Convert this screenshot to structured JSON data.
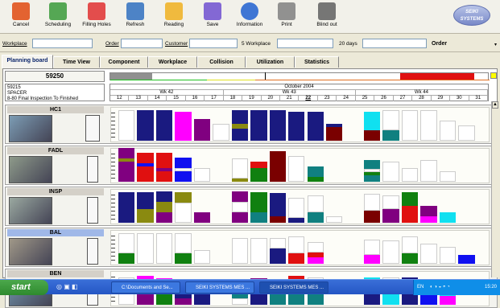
{
  "toolbar": {
    "buttons": [
      {
        "label": "Cancel",
        "icon": "cancel-icon"
      },
      {
        "label": "Scheduling",
        "icon": "scheduling-icon"
      },
      {
        "label": "Filling Holes",
        "icon": "filling-holes-icon"
      },
      {
        "label": "Refresh",
        "icon": "refresh-icon"
      },
      {
        "label": "Reading",
        "icon": "reading-icon"
      },
      {
        "label": "Save",
        "icon": "save-icon"
      },
      {
        "label": "Information",
        "icon": "information-icon"
      },
      {
        "label": "Print",
        "icon": "printer-icon"
      },
      {
        "label": "Blind out",
        "icon": "blind-out-icon"
      }
    ],
    "logo": "SEIKI SYSTEMS"
  },
  "filter": {
    "workplace": "Workplace",
    "order": "Order",
    "customer": "Customer",
    "workplace5": "5 Workplace",
    "days20": "20 days",
    "order2": "Order"
  },
  "tabs": [
    "Planning board",
    "Time View",
    "Component",
    "Workplace",
    "Collision",
    "Utilization",
    "Statistics"
  ],
  "board": {
    "work_order": "59250",
    "desc": [
      "59215",
      "SPACER",
      "8-80 Final Inspection To Finished"
    ],
    "month": "October 2004",
    "weeks": [
      "Wk 42",
      "Wk 43",
      "Wk 44"
    ],
    "days": [
      "12",
      "13",
      "14",
      "15",
      "16",
      "17",
      "18",
      "19",
      "20",
      "21",
      "22",
      "23",
      "24",
      "25",
      "26",
      "27",
      "28",
      "29",
      "30",
      "31"
    ]
  },
  "workcenters": [
    {
      "name": "HC1"
    },
    {
      "name": "FADL"
    },
    {
      "name": "INSP"
    },
    {
      "name": "BAL"
    },
    {
      "name": "BEN"
    }
  ],
  "taskbar": {
    "start": "start",
    "tasks": [
      "C:\\Documents and Se...",
      "SEIKI SYSTEMS MES ...",
      "SEIKI SYSTEMS MES ..."
    ],
    "tray": "EN",
    "clock": "15:20"
  },
  "colors": {
    "navy": "#1a1a80",
    "purple": "#800080",
    "magenta": "#ff00ff",
    "red": "#e01010",
    "darkred": "#7a0000",
    "olive": "#8a8a10",
    "green": "#108010",
    "teal": "#108080",
    "cyan": "#10e0f0",
    "blue": "#1010f0",
    "yellow": "#ffff00"
  }
}
